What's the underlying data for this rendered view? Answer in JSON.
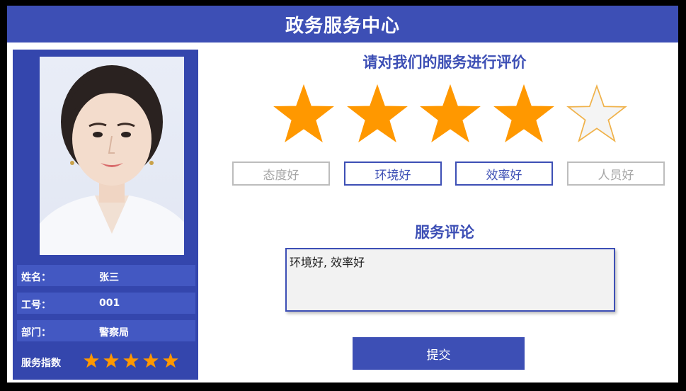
{
  "header": {
    "title": "政务服务中心"
  },
  "staff": {
    "name_label": "姓名：",
    "name_value": "张三",
    "id_label": "工号：",
    "id_value": "001",
    "dept_label": "部门：",
    "dept_value": "警察局",
    "score_label": "服务指数",
    "score_stars": 5,
    "score_max": 5
  },
  "rating": {
    "prompt": "请对我们的服务进行评价",
    "value": 4,
    "max": 5
  },
  "tags": [
    {
      "label": "态度好",
      "selected": false
    },
    {
      "label": "环境好",
      "selected": true
    },
    {
      "label": "效率好",
      "selected": true
    },
    {
      "label": "人员好",
      "selected": false
    }
  ],
  "comment": {
    "title": "服务评论",
    "value": "环境好, 效率好"
  },
  "submit_label": "提交",
  "colors": {
    "brand": "#3d4fb5",
    "panel": "#3446ad",
    "star": "#ff9800",
    "star_empty": "#f4f4f4"
  }
}
